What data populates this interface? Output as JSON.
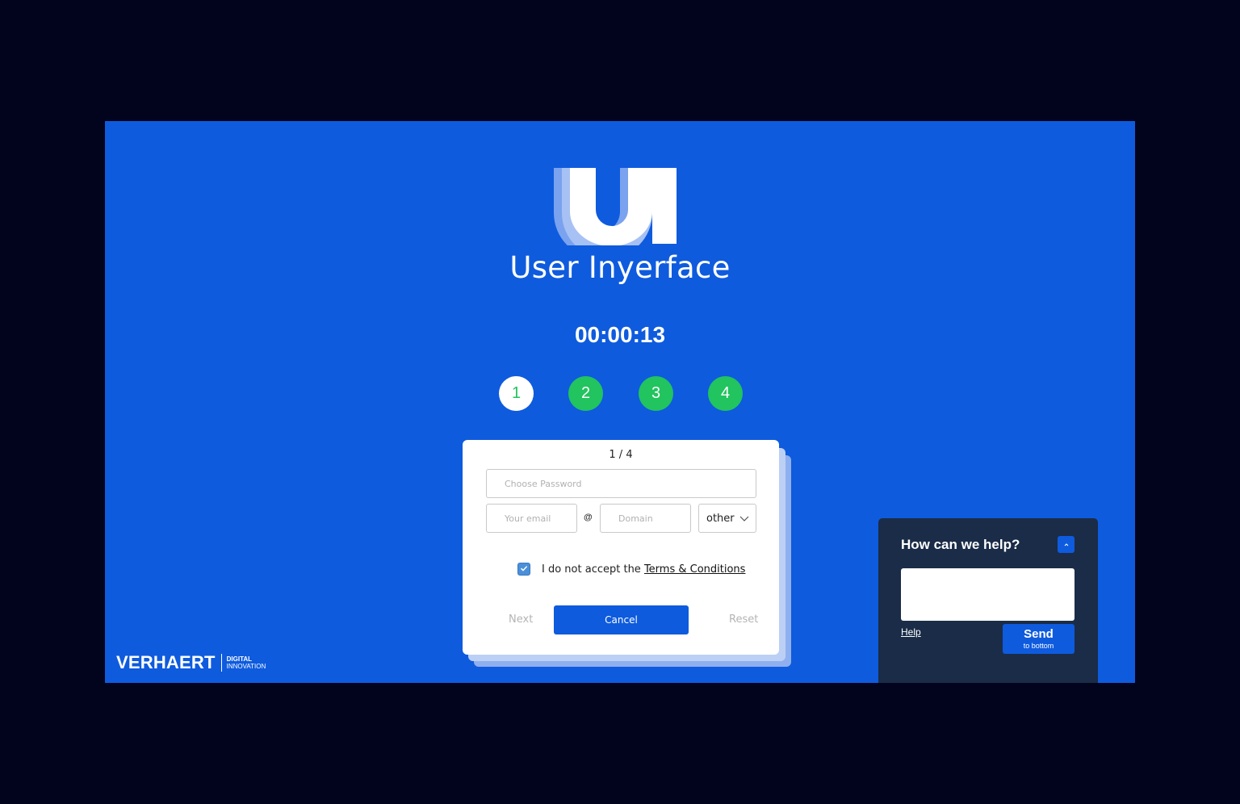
{
  "app": {
    "title": "User Inyerface",
    "logo_text": "UI"
  },
  "timer": "00:00:13",
  "steps": [
    "1",
    "2",
    "3",
    "4"
  ],
  "active_step": 1,
  "form": {
    "page_indicator": "1 / 4",
    "password_placeholder": "Choose Password",
    "email_placeholder": "Your email",
    "at_symbol": "@",
    "domain_placeholder": "Domain",
    "tld_selected": "other",
    "terms_prefix": "I do not accept the ",
    "terms_link": "Terms & Conditions",
    "terms_checked": true,
    "next_label": "Next",
    "cancel_label": "Cancel",
    "reset_label": "Reset"
  },
  "brand": {
    "name": "VERHAERT",
    "sub_line1": "DIGITAL",
    "sub_line2": "INNOVATION"
  },
  "help": {
    "title": "How can we help?",
    "help_link": "Help",
    "send_label": "Send",
    "send_sub": "to bottom"
  },
  "colors": {
    "background": "#0e5bde",
    "outer": "#01041c",
    "step_green": "#21c45e",
    "help_panel": "#1a2c47"
  },
  "icons": {
    "checkbox": "check-icon",
    "select_caret": "chevron-down-icon",
    "help_toggle": "chevron-up-icon"
  }
}
